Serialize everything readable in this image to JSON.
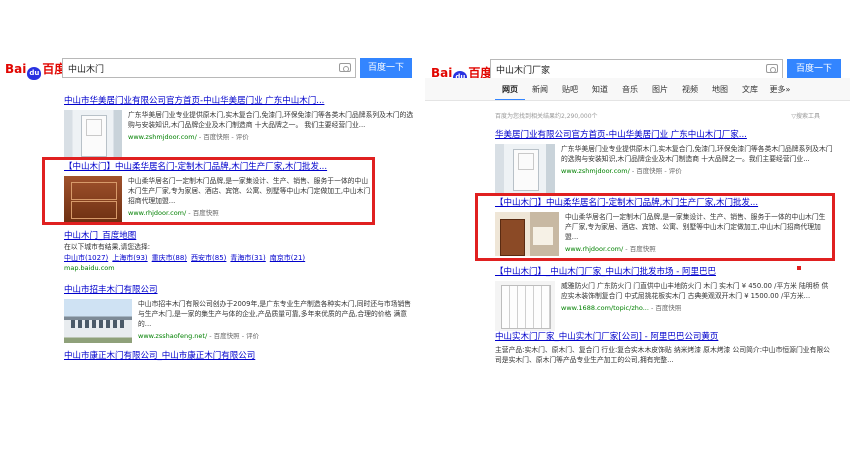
{
  "left": {
    "logo": {
      "bai": "Bai",
      "paw": "du",
      "du": "百度"
    },
    "search": {
      "query": "中山木门",
      "button": "百度一下"
    },
    "results": [
      {
        "title": "中山市华美居门业有限公司官方首页-中山华美居门业 广东中山木门...",
        "desc": "广东华美居门业专业提供原木门,实木复合门,免漆门,环保免漆门等各类木门品牌系列及木门的选购与安装知识,木门品牌企业及木门制造商 十大品牌之一。 我们主要经营门业...",
        "url": "www.zshmjdoor.com/",
        "snap": "- 百度快照 - 评价"
      },
      {
        "title": "【中山木门】中山柔华居名门-定制木门品牌,木门生产厂家,木门批发...",
        "desc": "中山柔华居名门一定制木门品牌,是一家集设计、生产、销售、服务于一体的中山木门生产厂家,专为家居、酒店、宾馆、公寓、别墅等中山木门定做加工,中山木门招商代理加盟...",
        "url": "www.rhjdoor.com/",
        "snap": "- 百度快照"
      },
      {
        "title": "中山木门_百度地图",
        "desc": "在以下城市有结果,请您选择:",
        "cities": [
          "中山市(1027)",
          "上海市(93)",
          "重庆市(88)",
          "西安市(85)",
          "青海市(31)",
          "南京市(21)"
        ],
        "url": "map.baidu.com"
      },
      {
        "title": "中山市招丰木门有限公司",
        "desc": "中山市招丰木门有限公司创办于2009年,是广东专业生产制造各种实木门,同时还与市场销售与生产木门,是一家的集生产与体的企业,产品质量可靠,多年来优质的产品,合理的价格 满意的...",
        "url": "www.zsshaofeng.net/",
        "snap": "- 百度快照 - 评价"
      },
      {
        "title": "中山市康正木门有限公司_中山市康正木门有限公司",
        "url": "",
        "snap": ""
      }
    ]
  },
  "right": {
    "logo": {
      "bai": "Bai",
      "paw": "du",
      "du": "百度"
    },
    "search": {
      "query": "中山木门厂家",
      "button": "百度一下"
    },
    "tabs": [
      "网页",
      "新闻",
      "贴吧",
      "知道",
      "音乐",
      "图片",
      "视频",
      "地图",
      "文库",
      "更多»"
    ],
    "stats": "百度为您找到相关结果约2,290,000个",
    "tools": "搜索工具",
    "results": [
      {
        "title": "华美居门业有限公司官方首页-中山华美居门业 广东中山木门厂家...",
        "desc": "广东华美居门业专业提供原木门,实木复合门,免漆门,环保免漆门等各类木门品牌系列及木门的选购与安装知识,木门品牌企业及木门制造商 十大品牌之一。我们主要经营门业...",
        "url": "www.zshmjdoor.com/",
        "snap": "- 百度快照 - 评价"
      },
      {
        "title": "【中山木门】中山柔华居名门-定制木门品牌,木门生产厂家,木门批发...",
        "desc": "中山柔华居名门一定制木门品牌,是一家集设计、生产、销售、服务于一体的中山木门生产厂家,专为家居、酒店、宾馆、公寓、别墅等中山木门定做加工,中山木门招商代理加盟...",
        "url": "www.rhjdoor.com/",
        "snap": "- 百度快照"
      },
      {
        "title": "【中山木门】_中山木门厂家_中山木门批发市场 - 阿里巴巴",
        "desc": "威雅防火门 广东防火门 门直供中山丰地防火门 木门 实木门 ¥ 450.00 /平方米 陆明桥 供应实木装饰制复合门 中式屈挑花板实木门 古典美观双开木门 ¥ 1500.00 /平方米...",
        "url": "www.1688.com/topic/zho...",
        "snap": "- 百度快照"
      },
      {
        "title": "中山实木门厂家_中山实木门厂家[公司] - 阿里巴巴公司黄页",
        "desc": "主营产品:实木门、原木门、复合门 行业:复合实木木皮饰贴 纳米烤漆 原木烤漆 公司简介:中山市恒源门业有限公司是实木门、原木门等产品专业生产加工的公司,拥有完整...",
        "url": "",
        "snap": ""
      }
    ]
  },
  "colors": {
    "accent": "#3385ff",
    "link": "#0000cc",
    "keyword": "#cc0000",
    "url": "#008000",
    "highlight": "#e02020"
  }
}
